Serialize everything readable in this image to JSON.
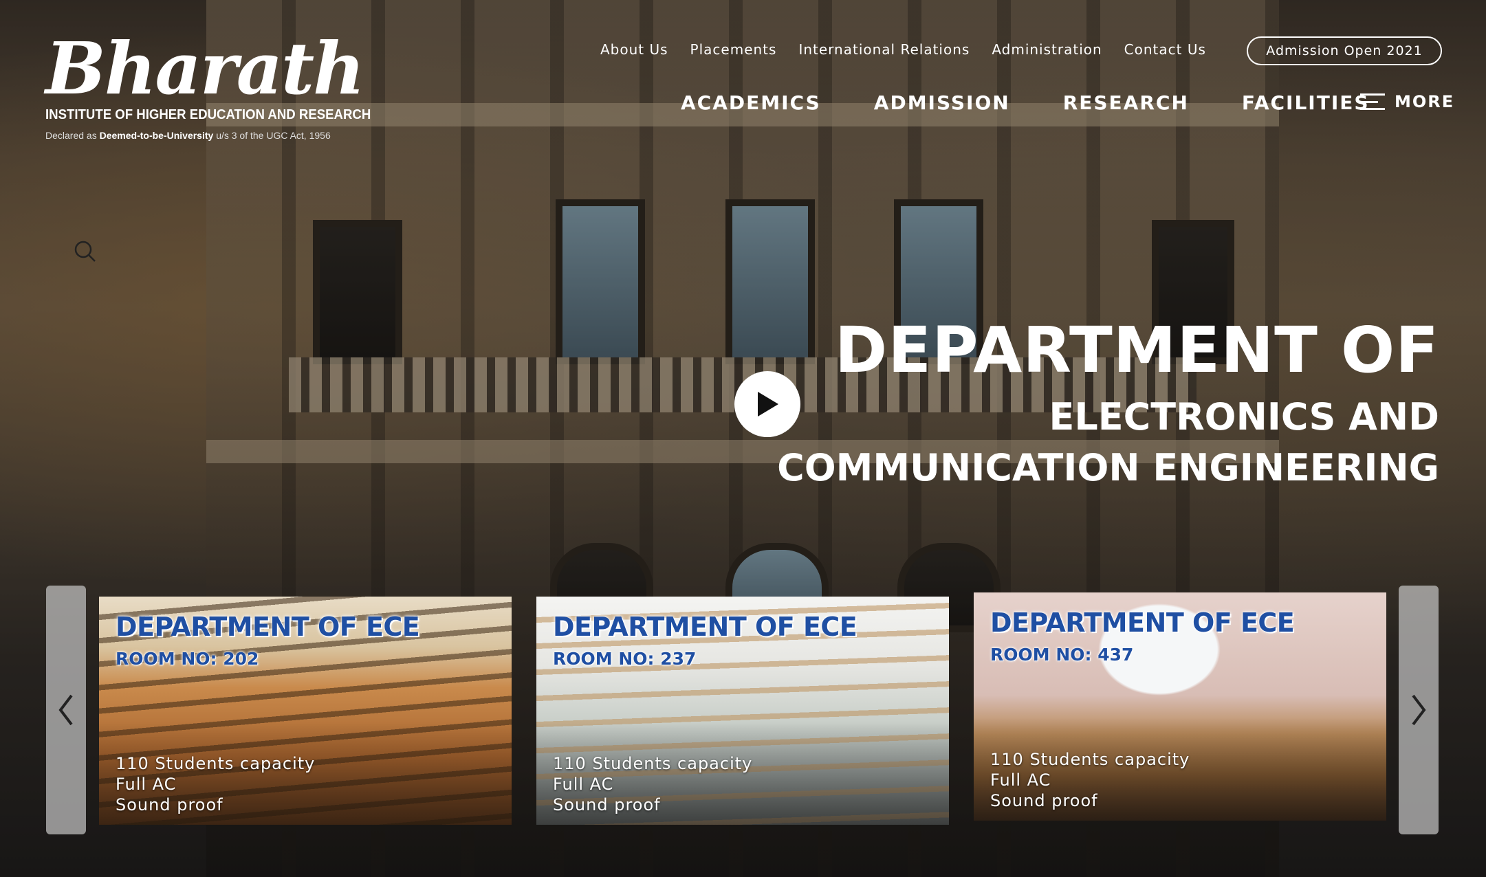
{
  "header": {
    "logo": {
      "wordmark": "Bharath",
      "subtitle": "INSTITUTE OF HIGHER EDUCATION AND RESEARCH",
      "declared_prefix": "Declared as",
      "declared_bold": "Deemed-to-be-University",
      "declared_suffix": "u/s 3 of the UGC Act, 1956"
    },
    "top_links": [
      "About Us",
      "Placements",
      "International Relations",
      "Administration",
      "Contact Us"
    ],
    "admission_button": "Admission Open 2021",
    "main_nav": [
      "ACADEMICS",
      "ADMISSION",
      "RESEARCH",
      "FACILITIES"
    ],
    "more_label": "MORE"
  },
  "hero": {
    "line1": "DEPARTMENT OF",
    "line2": "ELECTRONICS AND",
    "line3": "COMMUNICATION ENGINEERING"
  },
  "rooms": [
    {
      "title": "DEPARTMENT OF ECE",
      "room": "ROOM NO: 202",
      "features": [
        "110 Students capacity",
        "Full AC",
        "Sound proof"
      ]
    },
    {
      "title": "DEPARTMENT OF ECE",
      "room": "ROOM NO: 237",
      "features": [
        "110 Students capacity",
        "Full AC",
        "Sound proof"
      ]
    },
    {
      "title": "DEPARTMENT OF ECE",
      "room": "ROOM NO: 437",
      "features": [
        "110 Students capacity",
        "Full AC",
        "Sound proof"
      ]
    }
  ],
  "icons": {
    "search": "search-icon",
    "play": "play-icon",
    "menu": "hamburger-menu-icon",
    "prev": "chevron-left-icon",
    "next": "chevron-right-icon"
  }
}
